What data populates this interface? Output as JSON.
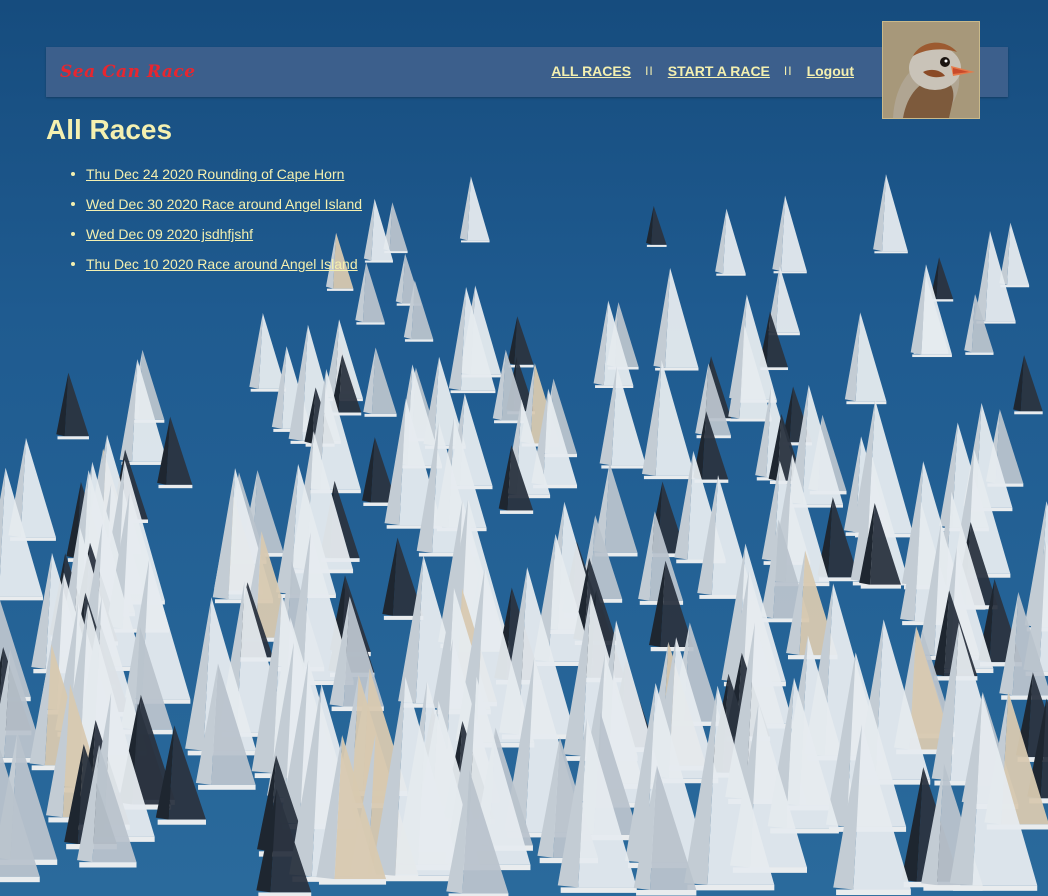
{
  "navbar": {
    "brand": "Sea Can Race",
    "links": {
      "all_races": "ALL RACES",
      "start_race": "START A RACE",
      "logout": "Logout"
    },
    "separator": "II"
  },
  "page": {
    "title": "All Races"
  },
  "races": [
    "Thu Dec 24 2020 Rounding of Cape Horn",
    "Wed Dec 30 2020 Race around Angel Island",
    "Wed Dec 09 2020 jsdhfjshf",
    "Thu Dec 10 2020 Race around Angel Island"
  ],
  "icons": {
    "avatar": "sparrow-avatar"
  },
  "colors": {
    "navbar_bg": "#3c5f8c",
    "link_text": "#f4f0b0",
    "brand_red": "#e8262f",
    "sea_blue": "#1d5a8f"
  }
}
